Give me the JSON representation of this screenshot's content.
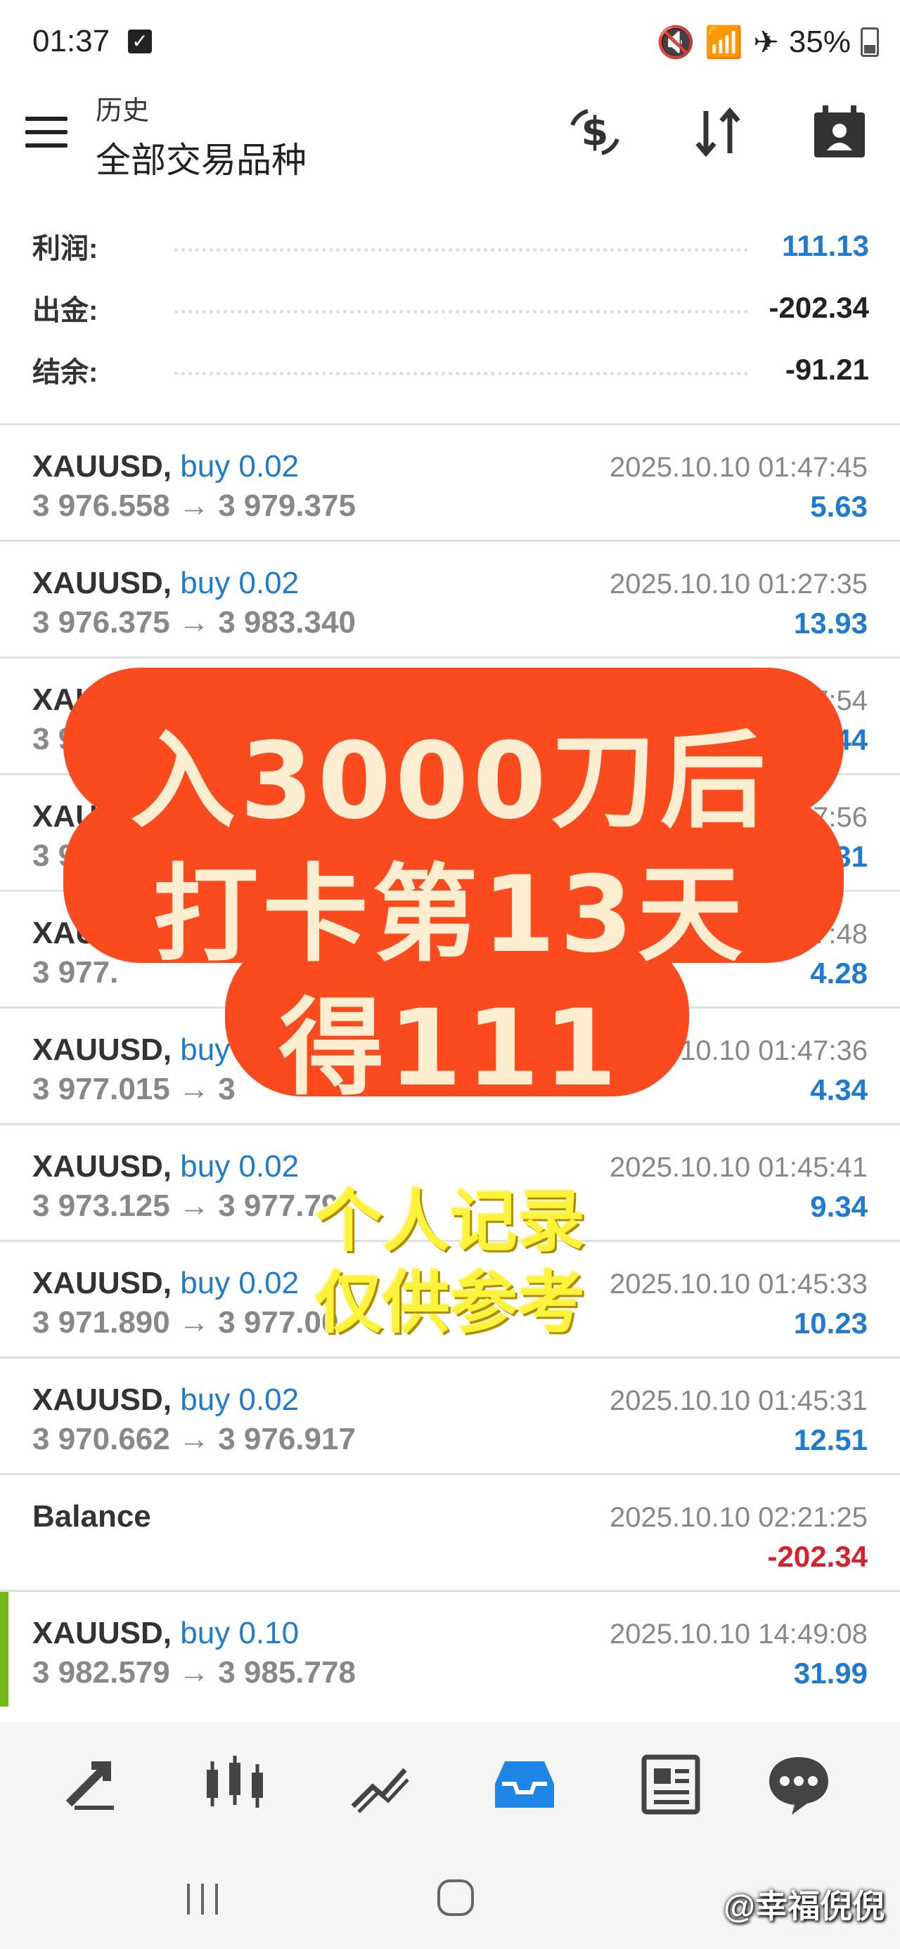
{
  "status": {
    "time": "01:37",
    "battery": "35%"
  },
  "toolbar": {
    "title": "历史",
    "subtitle": "全部交易品种"
  },
  "summary": [
    {
      "label": "利润:",
      "value": "111.13",
      "color": "#1f7bd0"
    },
    {
      "label": "出金:",
      "value": "-202.34",
      "color": "#222222"
    },
    {
      "label": "结余:",
      "value": "-91.21",
      "color": "#222222"
    }
  ],
  "trades": [
    {
      "symbol": "XAUUSD,",
      "action": "buy 0.02",
      "prices": "3 976.558 → 3 979.375",
      "date": "2025.10.10 01:47:45",
      "profit": "5.63",
      "profit_color": "#1f7bd0"
    },
    {
      "symbol": "XAUUSD,",
      "action": "buy 0.02",
      "prices": "3 976.375 → 3 983.340",
      "date": "2025.10.10 01:27:35",
      "profit": "13.93",
      "profit_color": "#1f7bd0"
    },
    {
      "symbol": "XAU",
      "action": "",
      "prices": "3 9",
      "date": "47:54",
      "profit": "2.44",
      "profit_color": "#1f7bd0"
    },
    {
      "symbol": "XAU",
      "action": "",
      "prices": "3 97",
      "date": "7:56",
      "profit": "5.31",
      "profit_color": "#1f7bd0"
    },
    {
      "symbol": "XAU",
      "action": "",
      "prices": "3 977.",
      "date": "7:48",
      "profit": "4.28",
      "profit_color": "#1f7bd0"
    },
    {
      "symbol": "XAUUSD,",
      "action": "buy",
      "prices": "3 977.015 → 3",
      "date": "5.10.10 01:47:36",
      "profit": "4.34",
      "profit_color": "#1f7bd0"
    },
    {
      "symbol": "XAUUSD,",
      "action": "buy 0.02",
      "prices": "3 973.125 → 3 977.79",
      "date": "2025.10.10 01:45:41",
      "profit": "9.34",
      "profit_color": "#1f7bd0"
    },
    {
      "symbol": "XAUUSD,",
      "action": "buy 0.02",
      "prices": "3 971.890 → 3 977.00",
      "date": "2025.10.10 01:45:33",
      "profit": "10.23",
      "profit_color": "#1f7bd0"
    },
    {
      "symbol": "XAUUSD,",
      "action": "buy 0.02",
      "prices": "3 970.662 → 3 976.917",
      "date": "2025.10.10 01:45:31",
      "profit": "12.51",
      "profit_color": "#1f7bd0"
    },
    {
      "symbol": "Balance",
      "action": "",
      "prices": "",
      "date": "2025.10.10 02:21:25",
      "profit": "-202.34",
      "profit_color": "#d6202c"
    },
    {
      "symbol": "XAUUSD,",
      "action": "buy 0.10",
      "prices": "3 982.579 → 3 985.778",
      "date": "2025.10.10 14:49:08",
      "profit": "31.99",
      "profit_color": "#1f7bd0"
    }
  ],
  "overlay": {
    "line1": "入3000刀后",
    "line2": "打卡第13天",
    "line3": "得111",
    "note1": "个人记录",
    "note2": "仅供参考"
  },
  "watermark": "@幸福倪倪",
  "nav_icons": [
    "trade-icon",
    "quotes-icon",
    "chart-icon",
    "history-icon",
    "news-icon",
    "chat-icon"
  ]
}
